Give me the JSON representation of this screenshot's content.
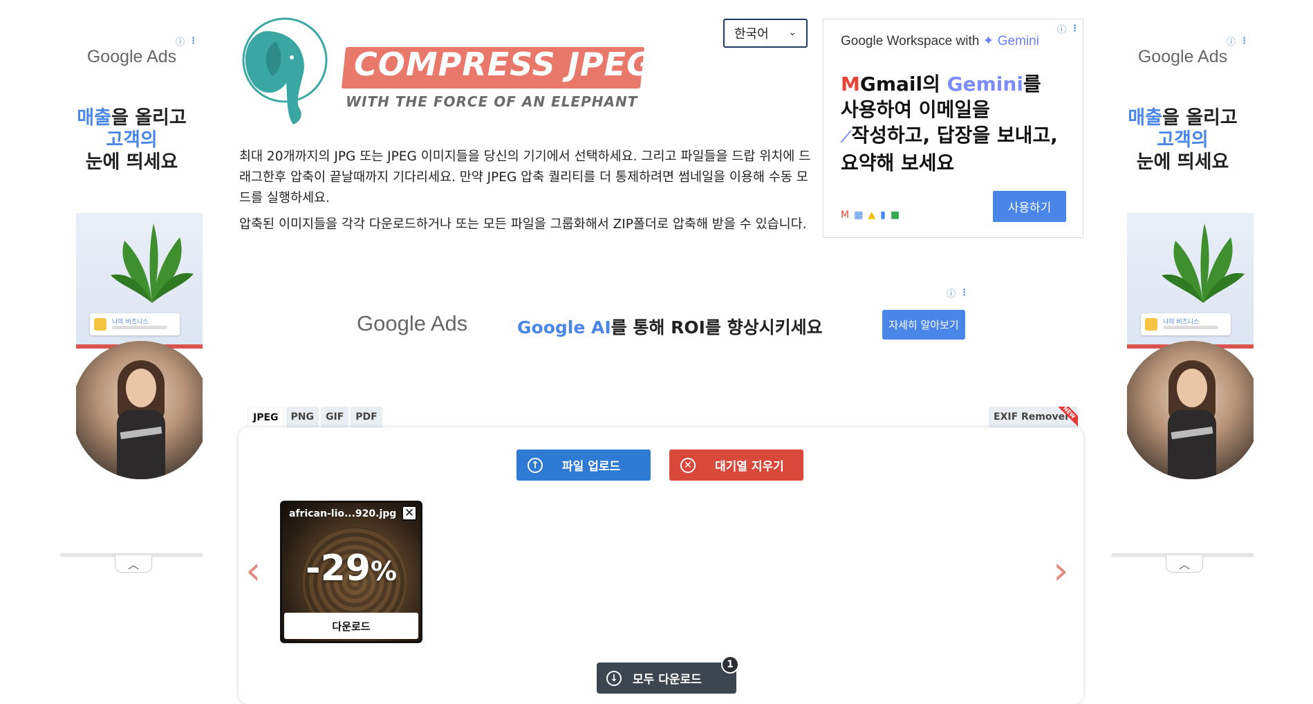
{
  "side_ads": {
    "logo_google": "Google",
    "logo_ads": "Ads",
    "line1_blue": "매출",
    "line1_rest": "을 올리고",
    "line2": "고객의",
    "line3": "눈에 띄세요",
    "biz_label": "나의 비즈니스"
  },
  "header": {
    "title": "COMPRESS JPEG",
    "subtitle": "WITH THE FORCE OF AN ELEPHANT",
    "language": "한국어"
  },
  "intro": {
    "p1": "최대 20개까지의 JPG 또는 JPEG 이미지들을 당신의 기기에서 선택하세요. 그리고 파일들을 드랍 위치에 드래그한후 압축이 끝날때까지 기다리세요. 만약 JPEG 압축 퀄리티를 더 통제하려면 썸네일을 이용해 수동 모드를 실행하세요.",
    "p2": "압축된 이미지들을 각각 다운로드하거나 또는 모든 파일을 그룹화해서 ZIP폴더로 압축해 받을 수 있습니다."
  },
  "workspace_ad": {
    "head_prefix": "Google Workspace with ",
    "head_gem": "✦ Gemini",
    "line1_prefix": "Gmail의 ",
    "line1_gem": "Gemini",
    "line1_suffix": "를",
    "line2": "사용하여 이메일을",
    "line3": "작성하고, 답장을 보내고,",
    "line4": "요약해 보세요",
    "button": "사용하기"
  },
  "mid_ad": {
    "logo_google": "Google",
    "logo_ads": "Ads",
    "msg_blue": "Google AI",
    "msg_rest": "를 통해 ROI를 향상시키세요",
    "cta": "자세히 알아보기"
  },
  "tabs": [
    "JPEG",
    "PNG",
    "GIF",
    "PDF"
  ],
  "exif_tab": "EXIF Remover",
  "exif_badge": "NEW",
  "tool": {
    "upload_label": "파일 업로드",
    "clear_label": "대기열 지우기",
    "file_name": "african-lio...920.jpg",
    "reduction": "-29",
    "percent": "%",
    "download_label": "다운로드",
    "download_all_label": "모두 다운로드",
    "download_count": "1"
  }
}
